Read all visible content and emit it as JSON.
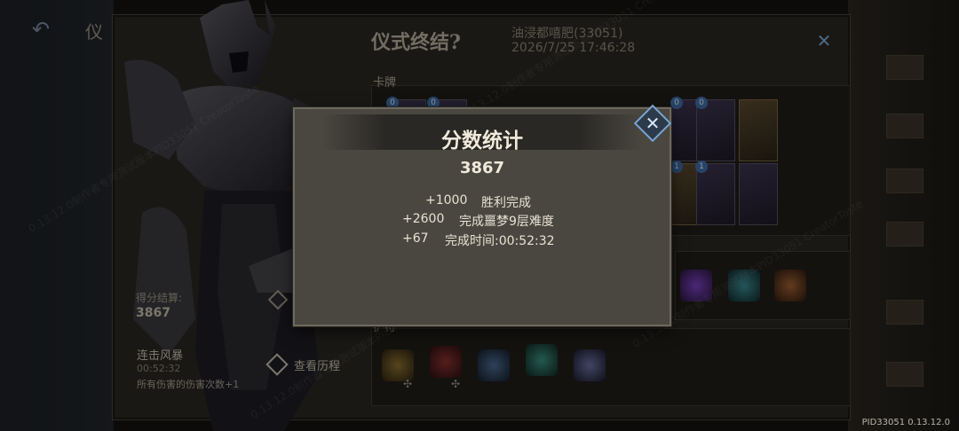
{
  "background": {
    "partial_title": "仪",
    "panel_title": "仪式终结?",
    "player_name": "油浸都嘻肥(33051)",
    "player_datetime": "2026/7/25 17:46:28",
    "section_cards_label": "卡牌",
    "section_relics_label": "护符",
    "score_label": "得分结算:",
    "score_value": "3867",
    "buff_name": "连击风暴",
    "buff_time": "00:52:32",
    "buff_desc": "所有伤害的伤害次数+1",
    "history_label": "查看历程",
    "card_costs": [
      "0",
      "0",
      "0",
      "1",
      "1"
    ]
  },
  "dialog": {
    "title": "分数统计",
    "total": "3867",
    "lines": [
      {
        "points": "+1000",
        "desc": "胜利完成"
      },
      {
        "points": "+2600",
        "desc": "完成噩梦9层难度"
      },
      {
        "points": "+67",
        "desc": "完成时间:00:52:32"
      }
    ]
  },
  "icons": {
    "back": "back-arrow-icon",
    "close": "close-icon",
    "history": "history-icon"
  },
  "colors": {
    "accent_blue": "#7aa4d0",
    "dialog_bg": "#4a4740",
    "text_light": "#f0eadc"
  },
  "version": "PID33051 0.13.12.0",
  "watermark": "0.13.12.0制作者专用测试版本PID33051 CreatorTaste"
}
